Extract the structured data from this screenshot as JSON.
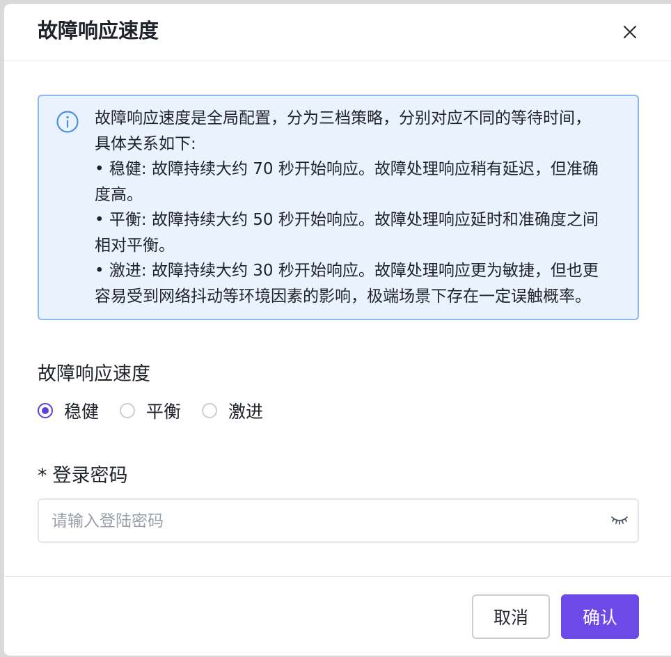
{
  "dialog": {
    "title": "故障响应速度"
  },
  "info": {
    "lines": [
      "故障响应速度是全局配置，分为三档策略，分别对应不同的等待时间，",
      "具体关系如下:",
      "• 稳健: 故障持续大约 70 秒开始响应。故障处理响应稍有延迟，但准确",
      "度高。",
      "• 平衡: 故障持续大约 50 秒开始响应。故障处理响应延时和准确度之间",
      "相对平衡。",
      "• 激进: 故障持续大约 30 秒开始响应。故障处理响应更为敏捷，但也更",
      "容易受到网络抖动等环境因素的影响，极端场景下存在一定误触概率。"
    ],
    "icon": "info-icon",
    "colors": {
      "background": "#eaf2fe",
      "border": "#8cb8f2",
      "icon": "#4a90e2"
    }
  },
  "speed": {
    "label": "故障响应速度",
    "options": [
      {
        "label": "稳健",
        "checked": true
      },
      {
        "label": "平衡",
        "checked": false
      },
      {
        "label": "激进",
        "checked": false
      }
    ]
  },
  "password": {
    "required_mark": "*",
    "label": "登录密码",
    "placeholder": "请输入登陆密码",
    "value": ""
  },
  "footer": {
    "cancel_label": "取消",
    "confirm_label": "确认"
  },
  "colors": {
    "accent": "#6d4ae8",
    "radio_checked": "#5b3fd6"
  }
}
